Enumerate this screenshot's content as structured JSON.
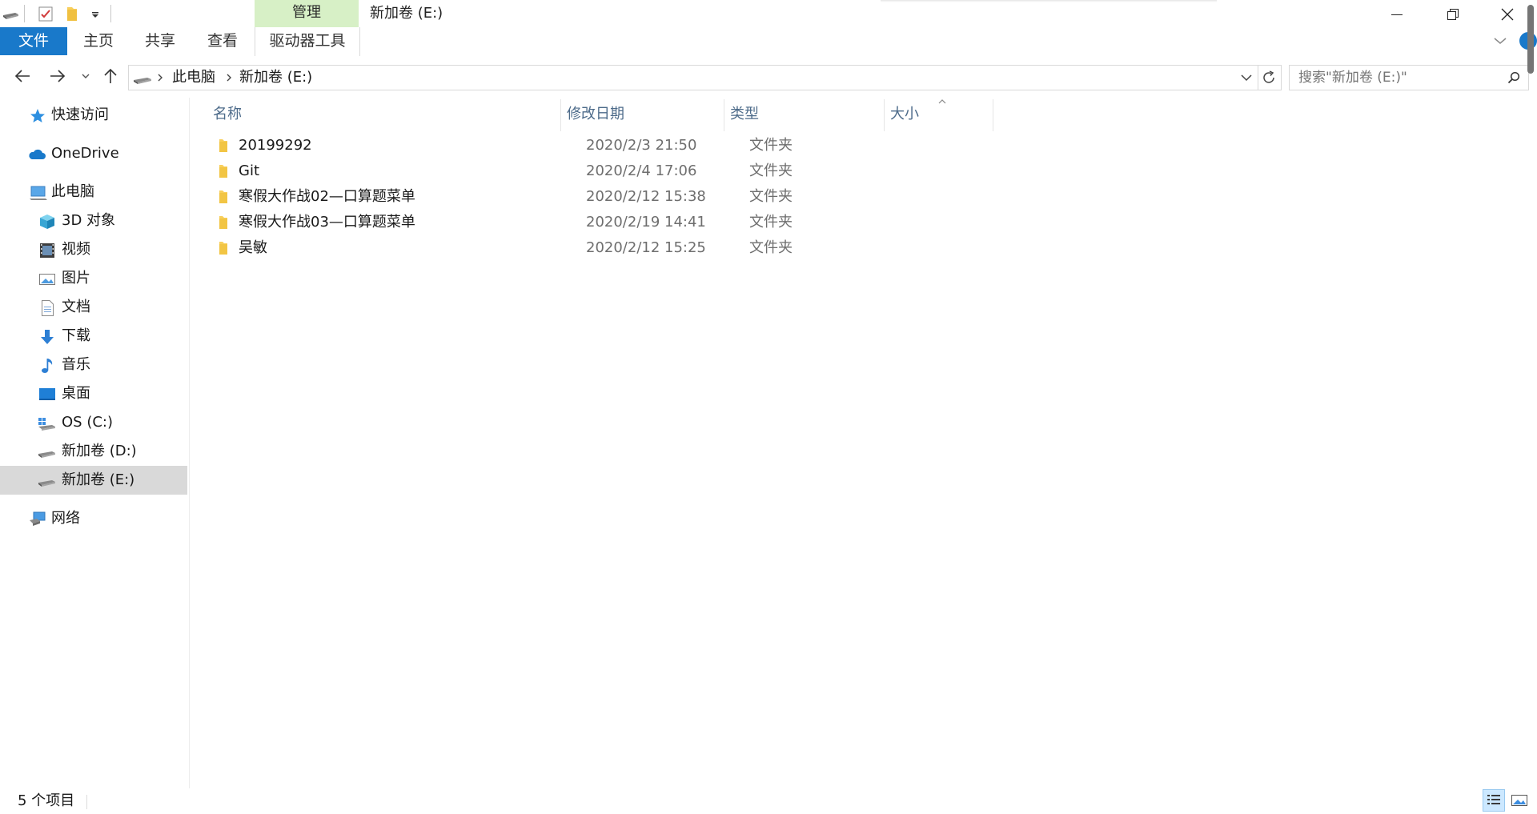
{
  "window": {
    "title": "新加卷 (E:)",
    "context_tab": "管理",
    "controls": [
      "minimize",
      "restore",
      "close"
    ]
  },
  "ribbon": {
    "file_tab": "文件",
    "tabs": [
      "主页",
      "共享",
      "查看"
    ],
    "context_subtab": "驱动器工具"
  },
  "address": {
    "crumbs": [
      "此电脑",
      "新加卷 (E:)"
    ]
  },
  "search": {
    "placeholder": "搜索\"新加卷 (E:)\""
  },
  "sidebar": {
    "quick_access": "快速访问",
    "onedrive": "OneDrive",
    "this_pc": "此电脑",
    "objects3d": "3D 对象",
    "videos": "视频",
    "pictures": "图片",
    "documents": "文档",
    "downloads": "下载",
    "music": "音乐",
    "desktop": "桌面",
    "drive_c": "OS (C:)",
    "drive_d": "新加卷 (D:)",
    "drive_e": "新加卷 (E:)",
    "network": "网络",
    "selected": "drive_e"
  },
  "columns": {
    "name": "名称",
    "date": "修改日期",
    "type": "类型",
    "size": "大小",
    "sorted_by": "size"
  },
  "files": [
    {
      "name": "20199292",
      "date": "2020/2/3 21:50",
      "type": "文件夹"
    },
    {
      "name": "Git",
      "date": "2020/2/4 17:06",
      "type": "文件夹"
    },
    {
      "name": "寒假大作战02—口算题菜单",
      "date": "2020/2/12 15:38",
      "type": "文件夹"
    },
    {
      "name": "寒假大作战03—口算题菜单",
      "date": "2020/2/19 14:41",
      "type": "文件夹"
    },
    {
      "name": "吴敏",
      "date": "2020/2/12 15:25",
      "type": "文件夹"
    }
  ],
  "status": {
    "item_count": "5 个项目"
  },
  "colors": {
    "accent": "#1979ca",
    "context_tab": "#d7f0c6",
    "folder": "#f8cf5c",
    "header_text": "#4d6b8a",
    "selection": "#d9d9d9"
  }
}
